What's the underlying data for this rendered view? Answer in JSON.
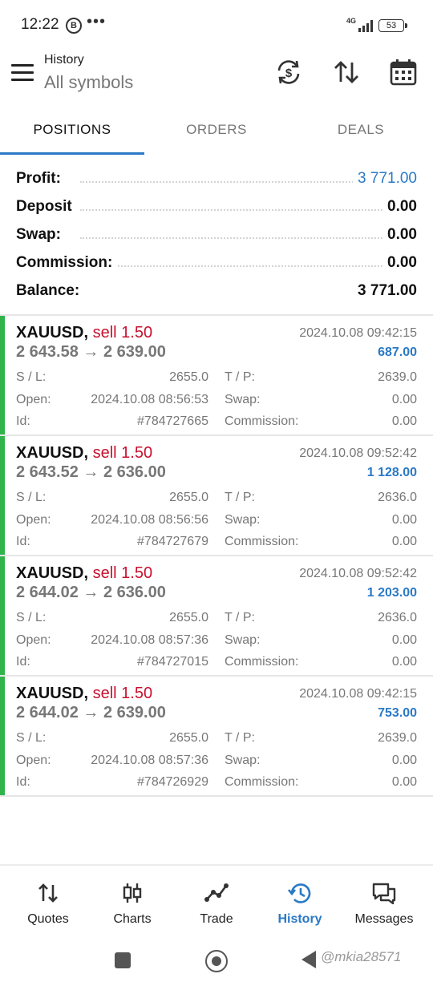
{
  "status_bar": {
    "time": "12:22",
    "b_badge": "B",
    "dots": "•••",
    "network": "4G",
    "battery": "53"
  },
  "header": {
    "title": "History",
    "subtitle": "All symbols"
  },
  "tabs": [
    {
      "label": "POSITIONS",
      "active": true
    },
    {
      "label": "ORDERS",
      "active": false
    },
    {
      "label": "DEALS",
      "active": false
    }
  ],
  "summary": [
    {
      "label": "Profit:",
      "value": "3 771.00",
      "highlight": true
    },
    {
      "label": "Deposit",
      "value": "0.00",
      "highlight": false
    },
    {
      "label": "Swap:",
      "value": "0.00",
      "highlight": false
    },
    {
      "label": "Commission:",
      "value": "0.00",
      "highlight": false
    },
    {
      "label": "Balance:",
      "value": "3 771.00",
      "highlight": false
    }
  ],
  "field_labels": {
    "sl": "S / L:",
    "tp": "T / P:",
    "open": "Open:",
    "swap": "Swap:",
    "id": "Id:",
    "commission": "Commission:"
  },
  "positions": [
    {
      "symbol": "XAUUSD",
      "side": "sell 1.50",
      "close_time": "2024.10.08 09:42:15",
      "open_price": "2 643.58",
      "close_price": "2 639.00",
      "profit": "687.00",
      "sl": "2655.0",
      "tp": "2639.0",
      "open_time": "2024.10.08 08:56:53",
      "swap": "0.00",
      "id": "#784727665",
      "commission": "0.00"
    },
    {
      "symbol": "XAUUSD",
      "side": "sell 1.50",
      "close_time": "2024.10.08 09:52:42",
      "open_price": "2 643.52",
      "close_price": "2 636.00",
      "profit": "1 128.00",
      "sl": "2655.0",
      "tp": "2636.0",
      "open_time": "2024.10.08 08:56:56",
      "swap": "0.00",
      "id": "#784727679",
      "commission": "0.00"
    },
    {
      "symbol": "XAUUSD",
      "side": "sell 1.50",
      "close_time": "2024.10.08 09:52:42",
      "open_price": "2 644.02",
      "close_price": "2 636.00",
      "profit": "1 203.00",
      "sl": "2655.0",
      "tp": "2636.0",
      "open_time": "2024.10.08 08:57:36",
      "swap": "0.00",
      "id": "#784727015",
      "commission": "0.00"
    },
    {
      "symbol": "XAUUSD",
      "side": "sell 1.50",
      "close_time": "2024.10.08 09:42:15",
      "open_price": "2 644.02",
      "close_price": "2 639.00",
      "profit": "753.00",
      "sl": "2655.0",
      "tp": "2639.0",
      "open_time": "2024.10.08 08:57:36",
      "swap": "0.00",
      "id": "#784726929",
      "commission": "0.00"
    }
  ],
  "bottom_nav": [
    {
      "label": "Quotes",
      "icon": "quotes-icon",
      "active": false
    },
    {
      "label": "Charts",
      "icon": "charts-icon",
      "active": false
    },
    {
      "label": "Trade",
      "icon": "trade-icon",
      "active": false
    },
    {
      "label": "History",
      "icon": "history-icon",
      "active": true
    },
    {
      "label": "Messages",
      "icon": "messages-icon",
      "active": false
    }
  ],
  "watermark": "@mkia28571",
  "colors": {
    "accent": "#2a79c6",
    "sell": "#c8102e",
    "position_bar": "#2fb34a"
  }
}
